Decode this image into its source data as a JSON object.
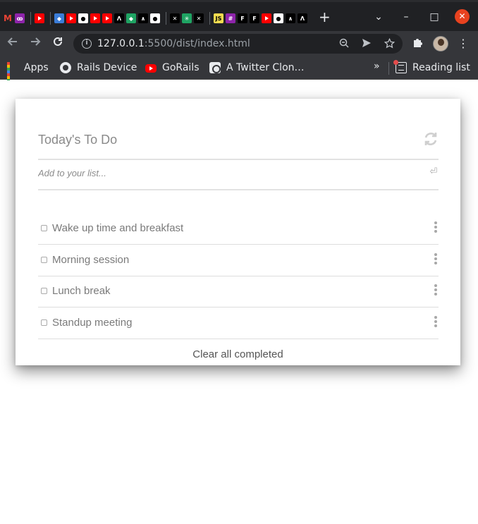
{
  "browser": {
    "new_tab_symbol": "+",
    "window_controls": {
      "dropdown": "⌄",
      "minimize": "–",
      "maximize": "□",
      "close": "✕"
    },
    "address": {
      "host": "127.0.0.1",
      "path": ":5500/dist/index.html"
    },
    "icons": {
      "back": "back-arrow-icon",
      "forward": "forward-arrow-icon",
      "reload": "reload-icon",
      "info": "info-icon",
      "zoom": "zoom-icon",
      "send": "send-icon",
      "star": "star-icon",
      "extensions": "puzzle-icon",
      "menu": "kebab-menu-icon"
    }
  },
  "bookmarks": {
    "items": [
      {
        "label": "Apps",
        "icon": "apps-grid-icon"
      },
      {
        "label": "Rails Device",
        "icon": "github-icon"
      },
      {
        "label": "GoRails",
        "icon": "youtube-icon"
      },
      {
        "label": "A Twitter Clon…",
        "icon": "twitter-clone-icon"
      }
    ],
    "overflow": "»",
    "reading_list": "Reading list"
  },
  "todo": {
    "title": "Today's To Do",
    "input_placeholder": "Add to your list...",
    "enter_symbol": "⏎",
    "items": [
      {
        "label": "Wake up time and breakfast",
        "completed": false
      },
      {
        "label": "Morning session",
        "completed": false
      },
      {
        "label": "Lunch break",
        "completed": false
      },
      {
        "label": "Standup meeting",
        "completed": false
      }
    ],
    "clear_label": "Clear all completed"
  },
  "colors": {
    "chrome_dark": "#202124",
    "chrome_toolbar": "#35363a",
    "close_button": "#e8421f",
    "text_muted": "#7a7a7a"
  }
}
